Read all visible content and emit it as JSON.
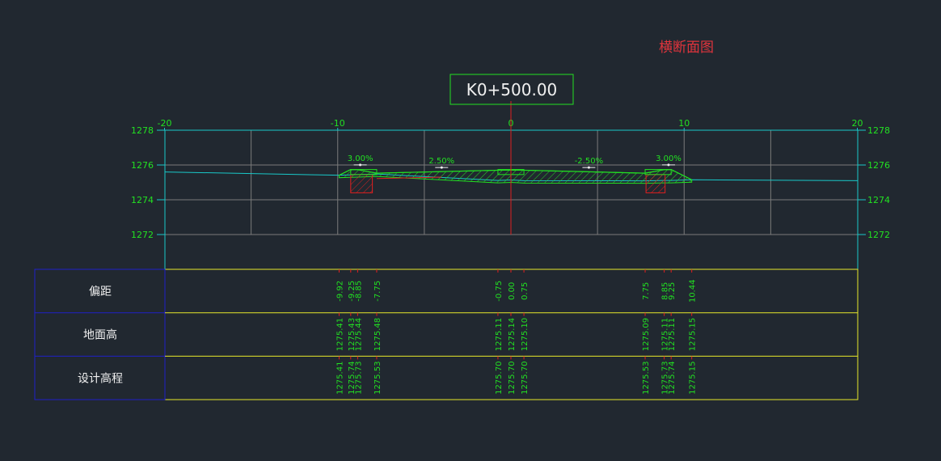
{
  "page_title": "横断面图",
  "station": "K0+500.00",
  "colors": {
    "background": "#212830",
    "text_green": "#22e022",
    "axis_cyan": "#19c8c8",
    "grid_gray": "#7a7a7a",
    "center_red": "#e02020",
    "table_yellow": "#e8e82a",
    "table_blue": "#2020c8",
    "label_white": "#f0f0f0",
    "title_red": "#e0343c"
  },
  "chart_data": {
    "type": "cross-section",
    "x_ticks": [
      -20,
      -10,
      0,
      10,
      20
    ],
    "y_ticks": [
      1278,
      1276,
      1274,
      1272
    ],
    "xlim": [
      -20,
      20
    ],
    "ylim": [
      1272,
      1278
    ],
    "grid": true,
    "slopes": [
      {
        "label": "3.00%",
        "x": -8.7,
        "y": 1276.1
      },
      {
        "label": "2.50%",
        "x": -4.0,
        "y": 1275.95
      },
      {
        "label": "-2.50%",
        "x": 4.5,
        "y": 1275.95
      },
      {
        "label": "3.00%",
        "x": 9.1,
        "y": 1276.1
      }
    ],
    "ground_line": [
      [
        -20,
        1275.6
      ],
      [
        -9.92,
        1275.41
      ],
      [
        -9.25,
        1275.43
      ],
      [
        -8.85,
        1275.44
      ],
      [
        -7.75,
        1275.48
      ],
      [
        -0.75,
        1275.11
      ],
      [
        0.0,
        1275.14
      ],
      [
        0.75,
        1275.1
      ],
      [
        7.75,
        1275.09
      ],
      [
        8.85,
        1275.11
      ],
      [
        9.25,
        1275.11
      ],
      [
        10.44,
        1275.15
      ],
      [
        20,
        1275.1
      ]
    ],
    "design_line": [
      [
        -9.92,
        1275.41
      ],
      [
        -9.25,
        1275.74
      ],
      [
        -8.85,
        1275.73
      ],
      [
        -7.75,
        1275.53
      ],
      [
        -0.75,
        1275.7
      ],
      [
        0.0,
        1275.7
      ],
      [
        0.75,
        1275.7
      ],
      [
        7.75,
        1275.53
      ],
      [
        8.85,
        1275.73
      ],
      [
        9.25,
        1275.74
      ],
      [
        10.44,
        1275.15
      ]
    ],
    "table": {
      "rows": [
        {
          "label": "偏距",
          "values": [
            "-9.92",
            "-9.25",
            "-8.85",
            "-7.75",
            "-0.75",
            "0.00",
            "0.75",
            "7.75",
            "8.85",
            "9.25",
            "10.44"
          ]
        },
        {
          "label": "地面高",
          "values": [
            "1275.41",
            "1275.43",
            "1275.44",
            "1275.48",
            "1275.11",
            "1275.14",
            "1275.10",
            "1275.09",
            "1275.11",
            "1275.11",
            "1275.15"
          ]
        },
        {
          "label": "设计高程",
          "values": [
            "1275.41",
            "1275.74",
            "1275.73",
            "1275.53",
            "1275.70",
            "1275.70",
            "1275.70",
            "1275.53",
            "1275.73",
            "1275.74",
            "1275.15"
          ]
        }
      ],
      "offsets": [
        -9.92,
        -9.25,
        -8.85,
        -7.75,
        -0.75,
        0.0,
        0.75,
        7.75,
        8.85,
        9.25,
        10.44
      ]
    }
  }
}
